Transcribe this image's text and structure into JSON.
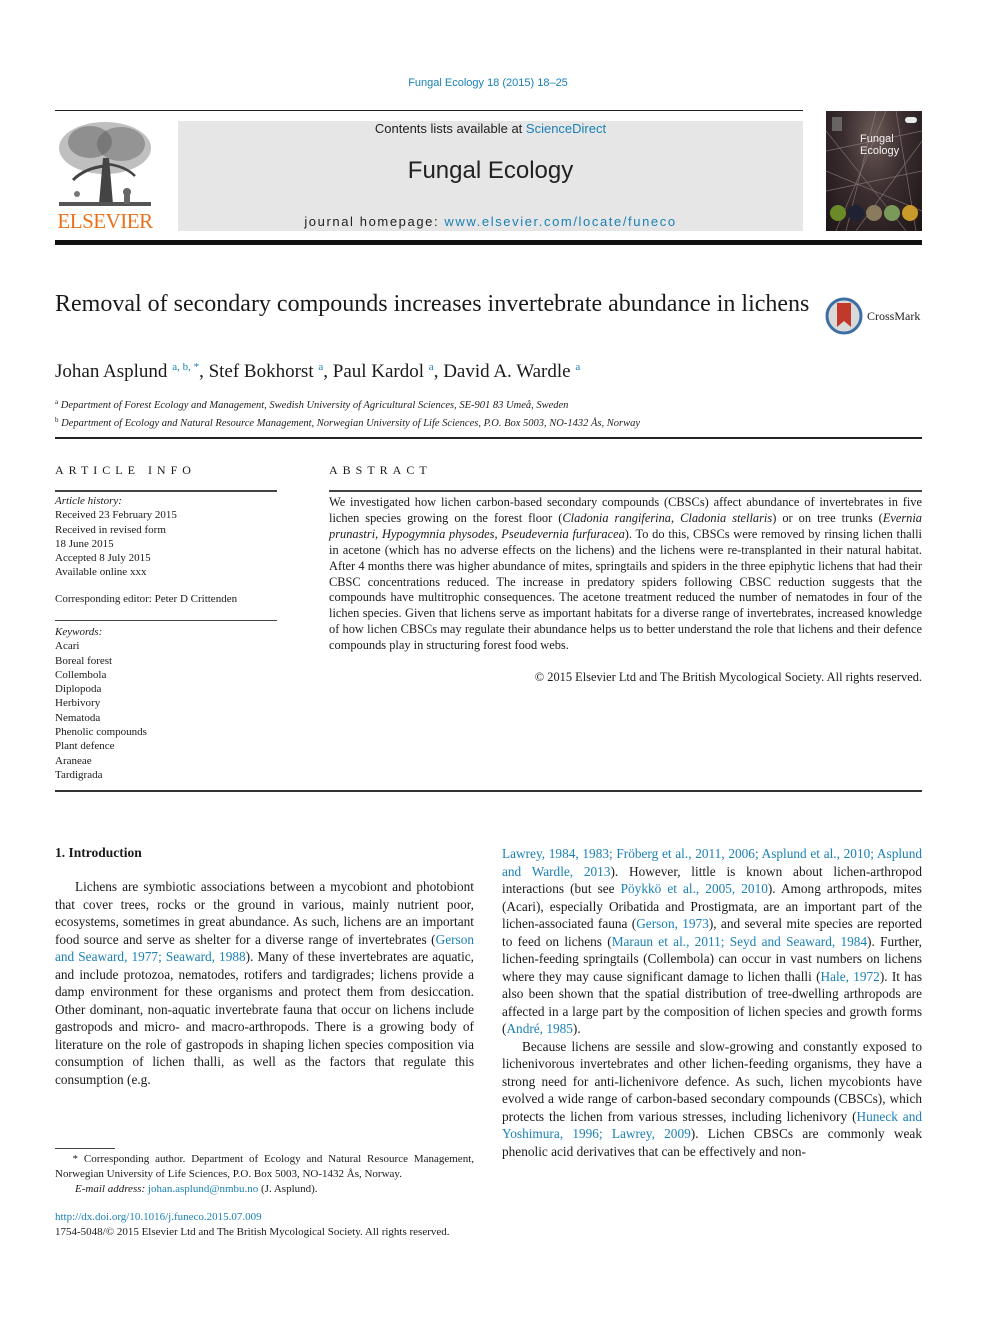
{
  "header": {
    "journal_reference": "Fungal Ecology 18 (2015) 18–25",
    "publisher_logo_text": "ELSEVIER",
    "contents_prefix": "Contents lists available at ",
    "contents_link": "ScienceDirect",
    "journal_name": "Fungal Ecology",
    "homepage_prefix": "journal homepage: ",
    "homepage_link": "www.elsevier.com/locate/funeco",
    "cover_title_line1": "Fungal",
    "cover_title_line2": "Ecology",
    "colors": {
      "link": "#1a80b6",
      "elsevier_orange": "#e9711c",
      "header_box": "#e6e6e6"
    }
  },
  "article": {
    "title": "Removal of secondary compounds increases invertebrate abundance in lichens",
    "crossmark_label": "CrossMark",
    "authors": [
      {
        "name": "Johan Asplund",
        "affil": "a, b, *"
      },
      {
        "name": "Stef Bokhorst",
        "affil": "a"
      },
      {
        "name": "Paul Kardol",
        "affil": "a"
      },
      {
        "name": "David A. Wardle",
        "affil": "a"
      }
    ],
    "affiliations": [
      {
        "mark": "a",
        "text": "Department of Forest Ecology and Management, Swedish University of Agricultural Sciences, SE-901 83 Umeå, Sweden"
      },
      {
        "mark": "b",
        "text": "Department of Ecology and Natural Resource Management, Norwegian University of Life Sciences, P.O. Box 5003, NO-1432 Ås, Norway"
      }
    ]
  },
  "article_info": {
    "heading": "ARTICLE INFO",
    "history_label": "Article history:",
    "history": [
      "Received 23 February 2015",
      "Received in revised form",
      "18 June 2015",
      "Accepted 8 July 2015",
      "Available online xxx"
    ],
    "editor": "Corresponding editor: Peter D Crittenden",
    "keywords_label": "Keywords:",
    "keywords": [
      "Acari",
      "Boreal forest",
      "Collembola",
      "Diplopoda",
      "Herbivory",
      "Nematoda",
      "Phenolic compounds",
      "Plant defence",
      "Araneae",
      "Tardigrada"
    ]
  },
  "abstract": {
    "heading": "ABSTRACT",
    "p1": "We investigated how lichen carbon-based secondary compounds (CBSCs) affect abundance of invertebrates in five lichen species growing on the forest floor (",
    "sp1": "Cladonia rangiferina",
    "sep1": ", ",
    "sp2": "Cladonia stellaris",
    "p2": ") or on tree trunks (",
    "sp3": "Evernia prunastri, Hypogymnia physodes, Pseudevernia furfuracea",
    "p3": "). To do this, CBSCs were removed by rinsing lichen thalli in acetone (which has no adverse effects on the lichens) and the lichens were re-transplanted in their natural habitat. After 4 months there was higher abundance of mites, springtails and spiders in the three epiphytic lichens that had their CBSC concentrations reduced. The increase in predatory spiders following CBSC reduction suggests that the compounds have multitrophic consequences. The acetone treatment reduced the number of nematodes in four of the lichen species. Given that lichens serve as important habitats for a diverse range of invertebrates, increased knowledge of how lichen CBSCs may regulate their abundance helps us to better understand the role that lichens and their defence compounds play in structuring forest food webs.",
    "copyright": "© 2015 Elsevier Ltd and The British Mycological Society. All rights reserved."
  },
  "introduction": {
    "heading": "1.  Introduction",
    "left": {
      "t1": "Lichens are symbiotic associations between a mycobiont and photobiont that cover trees, rocks or the ground in various, mainly nutrient poor, ecosystems, sometimes in great abundance. As such, lichens are an important food source and serve as shelter for a diverse range of invertebrates (",
      "c1": "Gerson and Seaward, 1977; Seaward, 1988",
      "t2": "). Many of these invertebrates are aquatic, and include protozoa, nematodes, rotifers and tardigrades; lichens provide a damp environment for these organisms and protect them from desiccation. Other dominant, non-aquatic invertebrate fauna that occur on lichens include gastropods and micro- and macro-arthropods. There is a growing body of literature on the role of gastropods in shaping lichen species composition via consumption of lichen thalli, as well as the factors that regulate this consumption (e.g."
    },
    "right": {
      "c1": "Lawrey, 1984, 1983; Fröberg et al., 2011, 2006; Asplund et al., 2010; Asplund and Wardle, 2013",
      "t1": "). However, little is known about lichen-arthropod interactions (but see ",
      "c2": "Pöykkö et al., 2005, 2010",
      "t2": "). Among arthropods, mites (Acari), especially Oribatida and Prostigmata, are an important part of the lichen-associated fauna (",
      "c3": "Gerson, 1973",
      "t3": "), and several mite species are reported to feed on lichens (",
      "c4": "Maraun et al., 2011; Seyd and Seaward, 1984",
      "t4": "). Further, lichen-feeding springtails (Collembola) can occur in vast numbers on lichens where they may cause significant damage to lichen thalli (",
      "c5": "Hale, 1972",
      "t5": "). It has also been shown that the spatial distribution of tree-dwelling arthropods are affected in a large part by the composition of lichen species and growth forms (",
      "c6": "André, 1985",
      "t6": ").",
      "p2_t1": "Because lichens are sessile and slow-growing and constantly exposed to lichenivorous invertebrates and other lichen-feeding organisms, they have a strong need for anti-lichenivore defence. As such, lichen mycobionts have evolved a wide range of carbon-based secondary compounds (CBSCs), which protects the lichen from various stresses, including lichenivory (",
      "p2_c1": "Huneck and Yoshimura, 1996; Lawrey, 2009",
      "p2_t2": "). Lichen CBSCs are commonly weak phenolic acid derivatives that can be effectively and non-"
    }
  },
  "footnote": {
    "corresponding": "* Corresponding author. Department of Ecology and Natural Resource Management, Norwegian University of Life Sciences, P.O. Box 5003, NO-1432 Ås, Norway.",
    "email_label": "E-mail address: ",
    "email": "johan.asplund@nmbu.no",
    "email_suffix": " (J. Asplund).",
    "doi": "http://dx.doi.org/10.1016/j.funeco.2015.07.009",
    "issn": "1754-5048/© 2015 Elsevier Ltd and The British Mycological Society. All rights reserved."
  }
}
